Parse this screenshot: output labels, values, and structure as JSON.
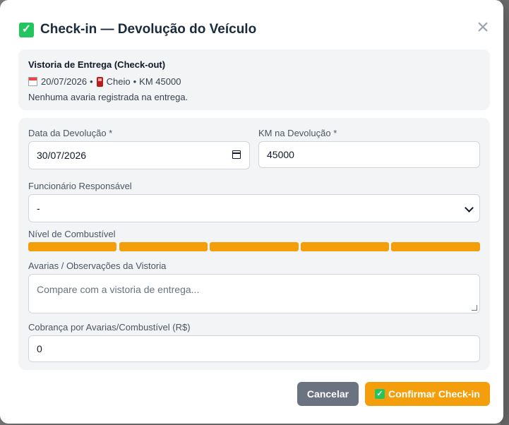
{
  "modal": {
    "title": "Check-in — Devolução do Veículo",
    "close_symbol": "×"
  },
  "checkout_info": {
    "heading": "Vistoria de Entrega (Check-out)",
    "date": "20/07/2026",
    "separator": "•",
    "fuel": "Cheio",
    "km": "KM 45000",
    "damage_note": "Nenhuma avaria registrada na entrega."
  },
  "form": {
    "return_date_label": "Data da Devolução *",
    "return_date_value": "30/07/2026",
    "return_km_label": "KM na Devolução *",
    "return_km_value": "45000",
    "employee_label": "Funcionário Responsável",
    "employee_value": "-",
    "fuel_level_label": "Nível de Combustível",
    "fuel_level_filled_segments": 5,
    "fuel_level_total_segments": 5,
    "damages_label": "Avarias / Observações da Vistoria",
    "damages_placeholder": "Compare com a vistoria de entrega...",
    "charge_label": "Cobrança por Avarias/Combustível (R$)",
    "charge_value": "0"
  },
  "actions": {
    "cancel_label": "Cancelar",
    "confirm_label": "Confirmar Check-in"
  },
  "colors": {
    "accent": "#f59e0b",
    "cancel": "#6b7280",
    "check_green": "#22c55e"
  },
  "icons": {
    "title": "check-mark-icon",
    "close": "close-icon",
    "calendar": "calendar-icon",
    "fuel": "fuel-pump-icon"
  }
}
